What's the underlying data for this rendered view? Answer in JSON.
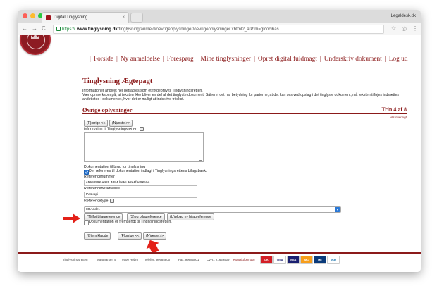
{
  "browser": {
    "tab_title": "Digital Tinglysning",
    "tab_close": "×",
    "user": "Legaldesk.dk",
    "url_https": "https://",
    "url_host": "www.tinglysning.dk",
    "url_path": "/tinglysning/anmeld/oevrigeoplysninger/oevrigeoplysninger.xhtml?_afPfm=glcoci6as",
    "back": "←",
    "forward": "→",
    "reload": "C",
    "star": "☆",
    "menu": "⋮",
    "traffic_light_colors": [
      "#fd5f57",
      "#fdbb2e",
      "#2ac940"
    ]
  },
  "nav": {
    "items": [
      "Forside",
      "Ny anmeldelse",
      "Forespørg",
      "Mine tinglysninger",
      "Opret digital fuldmagt",
      "Underskriv dokument",
      "Log ud"
    ],
    "separator": "|"
  },
  "page": {
    "title": "Tinglysning Ægtepagt",
    "intro_line1": "Informationer angivet her betragtes som et følgebrev til Tinglysningsretten.",
    "intro_line2": "Vær opmærksom på, at teksten ikke bliver en del af det tinglyste dokument. Såfremt det har betydning for parterne, at det kan ses ved opslag i det tinglyste dokument, må teksten tilføjes indsættes andet sted i dokumentet, hvor det er muligt at indskrive fritekst.",
    "section_title": "Øvrige oplysninger",
    "step": "Trin 4 af 8",
    "overview_link": "Vis oversigt"
  },
  "buttons": {
    "prev": "(F)orrige <<",
    "next": "(N)æste >>",
    "add_reference": "(T)ilføj bilagreference",
    "search_reference": "(S)øg bilagreference",
    "upload_reference": "(U)pload ny bilagreference",
    "save_draft": "(G)em kladde"
  },
  "form": {
    "info_label": "Information til Tinglysningsretten",
    "info_value": "",
    "doc_section_label": "Dokumentation til brug for tinglysning",
    "checkbox_ref_label": "Der refereres til dokumentation indlagt i Tinglysningsrettens bilagsbank.",
    "checkbox_ref_checked": true,
    "ref_number_label": "Referencenummer",
    "ref_number_value": "e55c8962-a426-4084-be1e-12a1f6a92b6a",
    "ref_desc_label": "Referencebeskrivelse",
    "ref_desc_value": "Paskopi",
    "ref_type_label": "Referencetype",
    "ref_type_value": "80 Andet.",
    "checkbox_sent_label": "Dokumentation er fremsendt til Tinglysningsretten.",
    "checkbox_sent_checked": false
  },
  "footer": {
    "org": "Tinglysningsretten",
    "address": "Majsmarken 5",
    "city": "9500 Hobro",
    "phone": "Telefon: 99685800",
    "fax": "Fax: 99685801",
    "cvr": "CVR.: 21659509",
    "contact": "Kontaktformular",
    "cards": [
      "DK",
      "VISA",
      "VISA",
      "MC",
      "ME",
      "JCB"
    ]
  },
  "colors": {
    "brand": "#8b1a1a",
    "annotation_arrow": "#e32119"
  },
  "icons": {
    "lock": "lock-icon",
    "help": "help-icon",
    "annotation": "red-arrow-icon"
  }
}
